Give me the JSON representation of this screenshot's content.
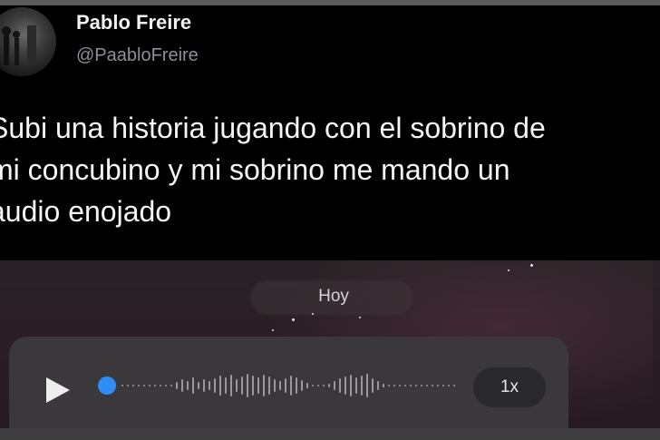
{
  "tweet": {
    "display_name": "Pablo Freire",
    "handle": "@PaabloFreire",
    "text_lines": [
      "Subi una historia jugando con el sobrino de",
      "mi concubino y mi sobrino me mando un",
      "audio enojado"
    ]
  },
  "chat_screenshot": {
    "date_label": "Hoy",
    "audio_message": {
      "playback_speed": "1x",
      "progress": 0.0
    }
  },
  "colors": {
    "background": "#000000",
    "name": "#f2f2f2",
    "handle": "#8b9096",
    "audio_bubble": "#3a383a",
    "progress_dot": "#2e8ef5"
  },
  "icons": [
    "avatar-photo",
    "play-icon",
    "waveform-icon"
  ]
}
